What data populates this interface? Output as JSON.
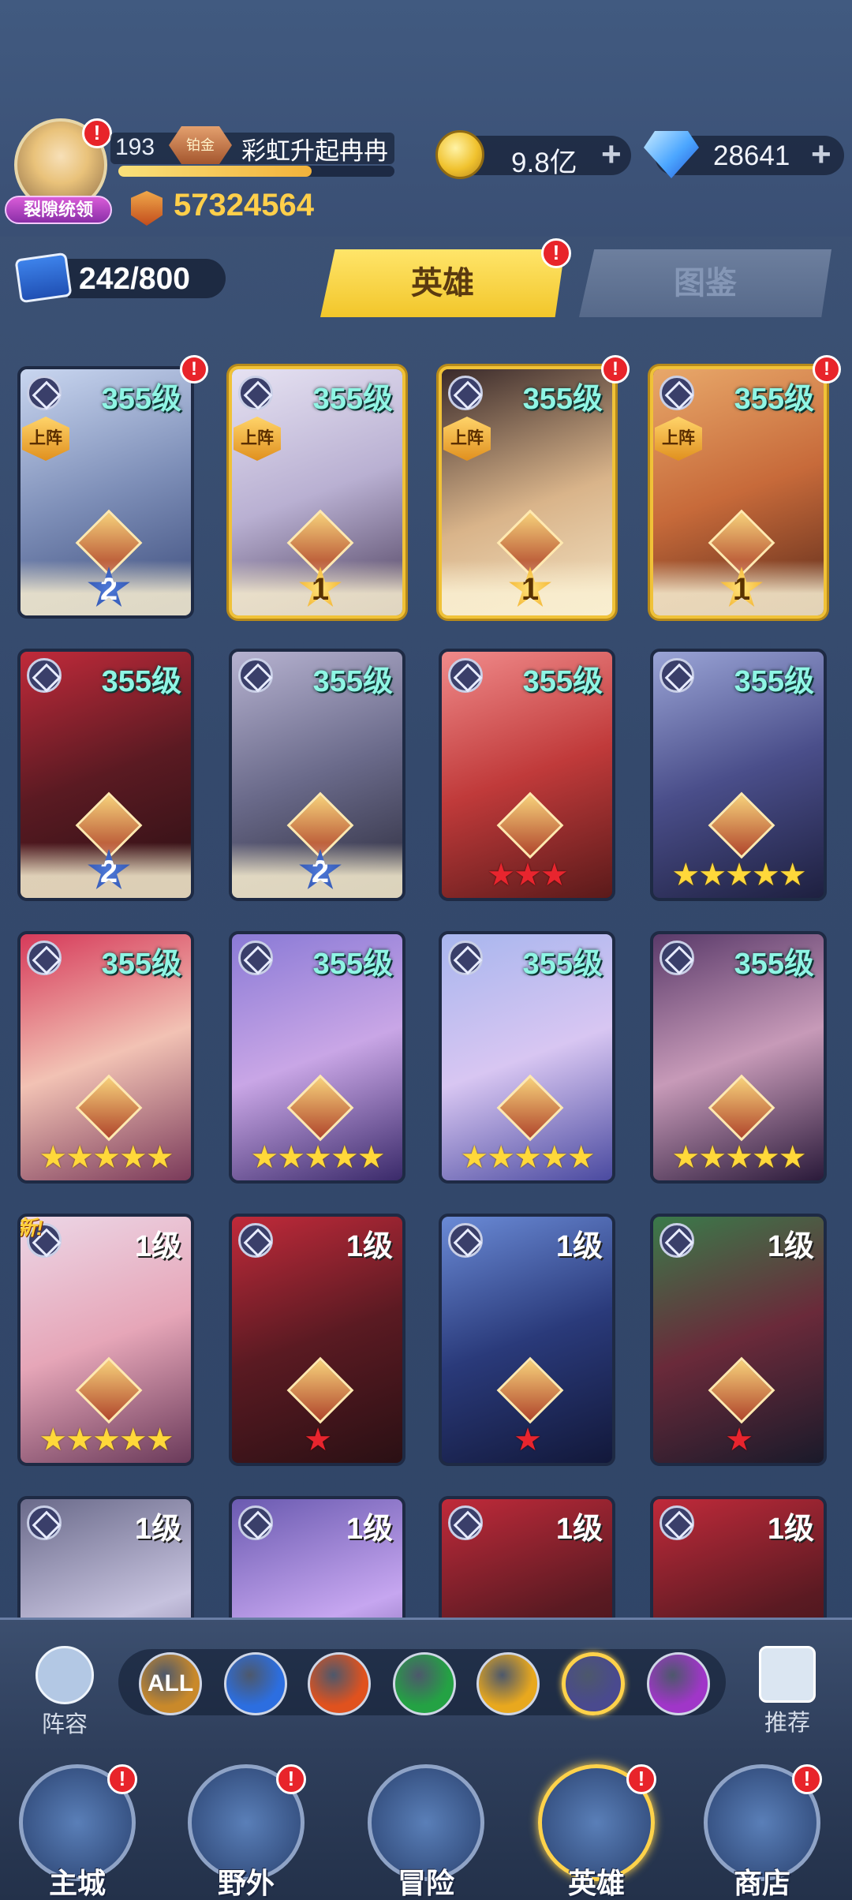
{
  "player": {
    "level": "193",
    "rank_label": "铂金",
    "name": "彩虹升起冉冉",
    "title_badge": "裂隙统领",
    "power": "57324564"
  },
  "currency": {
    "gold": "9.8亿",
    "gems": "28641",
    "plus": "+"
  },
  "collection": {
    "count": "242/800"
  },
  "tabs": {
    "heroes": "英雄",
    "codex": "图鉴"
  },
  "badge_mark": "!",
  "deploy_label": "上阵",
  "new_label": "新!",
  "heroes": [
    {
      "level": "355级",
      "deployed": true,
      "star_rank": "2",
      "rank_style": "silver",
      "gold_frame": false,
      "badge": true
    },
    {
      "level": "355级",
      "deployed": true,
      "star_rank": "1",
      "rank_style": "gold",
      "gold_frame": true,
      "badge": false
    },
    {
      "level": "355级",
      "deployed": true,
      "star_rank": "1",
      "rank_style": "gold",
      "gold_frame": true,
      "badge": true
    },
    {
      "level": "355级",
      "deployed": true,
      "star_rank": "1",
      "rank_style": "gold",
      "gold_frame": true,
      "badge": true
    },
    {
      "level": "355级",
      "star_rank": "2",
      "rank_style": "silver"
    },
    {
      "level": "355级",
      "star_rank": "2",
      "rank_style": "silver"
    },
    {
      "level": "355级",
      "stars": "★★★",
      "star_color": "red"
    },
    {
      "level": "355级",
      "stars": "★★★★★",
      "star_color": "yellow"
    },
    {
      "level": "355级",
      "stars": "★★★★★",
      "star_color": "yellow"
    },
    {
      "level": "355级",
      "stars": "★★★★★",
      "star_color": "yellow"
    },
    {
      "level": "355级",
      "stars": "★★★★★",
      "star_color": "yellow"
    },
    {
      "level": "355级",
      "stars": "★★★★★",
      "star_color": "yellow"
    },
    {
      "level": "1级",
      "stars": "★★★★★",
      "star_color": "yellow",
      "new": true
    },
    {
      "level": "1级",
      "stars": "★",
      "star_color": "red"
    },
    {
      "level": "1级",
      "stars": "★",
      "star_color": "red"
    },
    {
      "level": "1级",
      "stars": "★",
      "star_color": "red"
    },
    {
      "level": "1级"
    },
    {
      "level": "1级"
    },
    {
      "level": "1级"
    },
    {
      "level": "1级"
    }
  ],
  "filter": {
    "lineup_label": "阵容",
    "recommend_label": "推荐",
    "factions": [
      {
        "name": "all",
        "label": "ALL",
        "color": "#c9892a"
      },
      {
        "name": "water",
        "label": "",
        "color": "#2c6ee0"
      },
      {
        "name": "fire",
        "label": "",
        "color": "#e0521e"
      },
      {
        "name": "wind",
        "label": "",
        "color": "#24a244"
      },
      {
        "name": "light",
        "label": "",
        "color": "#e8a81e"
      },
      {
        "name": "dark",
        "label": "",
        "color": "#4a4a8e",
        "active": true
      },
      {
        "name": "chaos",
        "label": "",
        "color": "#a036c8"
      }
    ]
  },
  "nav": {
    "city": "主城",
    "wild": "野外",
    "adventure": "冒险",
    "heroes": "英雄",
    "shop": "商店"
  }
}
